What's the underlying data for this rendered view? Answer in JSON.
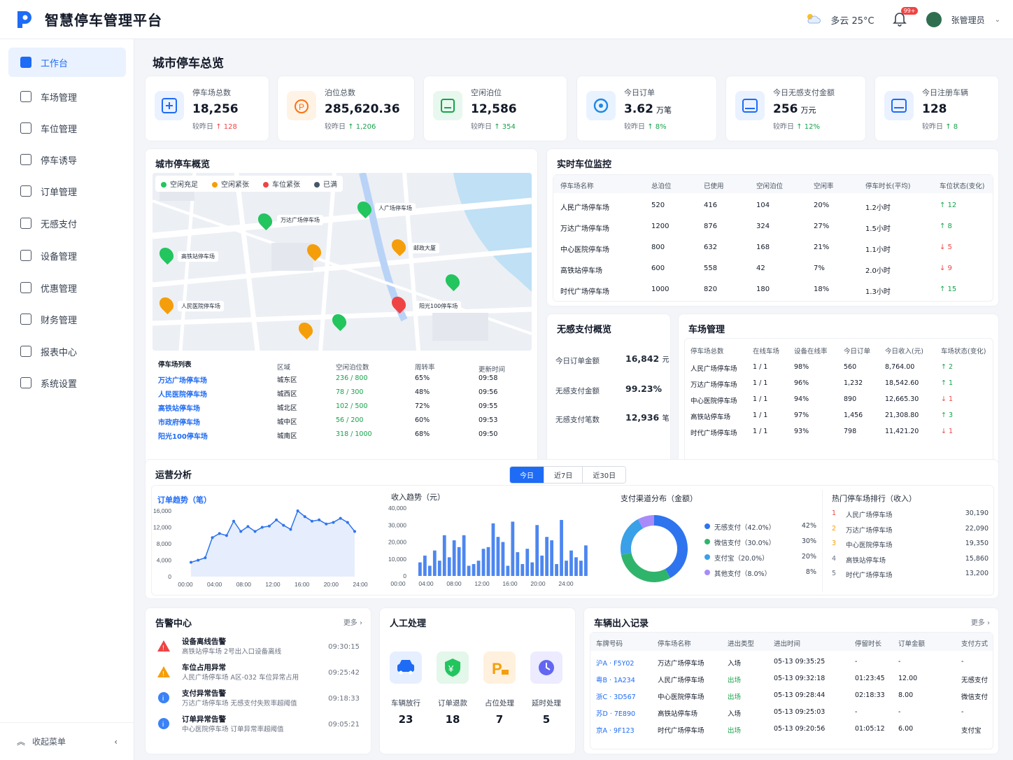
{
  "app": {
    "title": "智慧停车管理平台",
    "weather": "多云  25°C",
    "notif_badge": "99+",
    "user": "张管理员"
  },
  "nav": {
    "items": [
      "工作台",
      "车场管理",
      "车位管理",
      "停车诱导",
      "订单管理",
      "无感支付",
      "设备管理",
      "优惠管理",
      "财务管理",
      "报表中心",
      "系统设置"
    ],
    "collapse": "收起菜单"
  },
  "page_title": "城市停车总览",
  "kpis": [
    {
      "label": "停车场总数",
      "value": "18,256",
      "unit": "",
      "sub": "较昨日",
      "delta": "↑ 128"
    },
    {
      "label": "泊位总数",
      "value": "285,620.36",
      "unit": "",
      "sub": "较昨日",
      "delta": "↑ 1,206"
    },
    {
      "label": "空闲泊位",
      "value": "12,586",
      "unit": "",
      "sub": "较昨日",
      "delta": "↑ 354"
    },
    {
      "label": "今日订单",
      "value": "3.62",
      "unit": "万笔",
      "sub": "较昨日",
      "delta": "↑ 8%"
    },
    {
      "label": "今日无感支付金额",
      "value": "256",
      "unit": "万元",
      "sub": "较昨日",
      "delta": "↑ 12%"
    },
    {
      "label": "今日注册车辆",
      "value": "128",
      "unit": "",
      "sub": "较昨日",
      "delta": "↑ 8"
    }
  ],
  "overview": {
    "title": "城市停车概览",
    "legend": [
      {
        "label": "空闲充足",
        "color": "#22c55e"
      },
      {
        "label": "空闲紧张",
        "color": "#f59e0b"
      },
      {
        "label": "车位紧张",
        "color": "#ef4444"
      },
      {
        "label": "已满",
        "color": "#475569"
      }
    ],
    "map_labels": [
      "万达广场停车场",
      "人广场停车场",
      "邮政大厦",
      "高铁站停车场",
      "人民医院停车场",
      "阳光100停车场"
    ],
    "list_title": "停车场列表",
    "list_headers": [
      "区域",
      "空闲泊位数",
      "周转率",
      "更新时间"
    ],
    "rows": [
      [
        "万达广场停车场",
        "城东区",
        "236 / 800",
        "65%",
        "09:58"
      ],
      [
        "人民医院停车场",
        "城西区",
        "78 / 300",
        "48%",
        "09:56"
      ],
      [
        "高铁站停车场",
        "城北区",
        "102 / 500",
        "72%",
        "09:55"
      ],
      [
        "市政府停车场",
        "城中区",
        "56 / 200",
        "60%",
        "09:53"
      ],
      [
        "阳光100停车场",
        "城南区",
        "318 / 1000",
        "68%",
        "09:50"
      ]
    ]
  },
  "monitor": {
    "title": "实时车位监控",
    "headers": [
      "停车场名称",
      "总泊位",
      "已使用",
      "空闲泊位",
      "空闲率",
      "停车时长(平均)",
      "车位状态(变化)"
    ],
    "rows": [
      [
        "人民广场停车场",
        "520",
        "416",
        "104",
        "20%",
        "1.2小时",
        "↑ 12"
      ],
      [
        "万达广场停车场",
        "1200",
        "876",
        "324",
        "27%",
        "1.5小时",
        "↑ 8"
      ],
      [
        "中心医院停车场",
        "800",
        "632",
        "168",
        "21%",
        "1.1小时",
        "↓ 5"
      ],
      [
        "高铁站停车场",
        "600",
        "558",
        "42",
        "7%",
        "2.0小时",
        "↓ 9"
      ],
      [
        "时代广场停车场",
        "1000",
        "820",
        "180",
        "18%",
        "1.3小时",
        "↑ 15"
      ]
    ]
  },
  "pay": {
    "title": "无感支付概览",
    "items": [
      {
        "label": "今日订单金额",
        "value": "16,842",
        "unit": "元"
      },
      {
        "label": "无感支付金额",
        "value": "99.23%",
        "unit": ""
      },
      {
        "label": "无感支付笔数",
        "value": "12,936",
        "unit": "笔"
      }
    ]
  },
  "lots": {
    "title": "车场管理",
    "headers": [
      "停车场总数",
      "在线车场",
      "设备在线率",
      "今日订单",
      "今日收入(元)",
      "车场状态(变化)"
    ],
    "rows": [
      [
        "人民广场停车场",
        "1 / 1",
        "98%",
        "560",
        "8,764.00",
        "↑ 2"
      ],
      [
        "万达广场停车场",
        "1 / 1",
        "96%",
        "1,232",
        "18,542.60",
        "↑ 1"
      ],
      [
        "中心医院停车场",
        "1 / 1",
        "94%",
        "890",
        "12,665.30",
        "↓ 1"
      ],
      [
        "高铁站停车场",
        "1 / 1",
        "97%",
        "1,456",
        "21,308.80",
        "↑ 3"
      ],
      [
        "时代广场停车场",
        "1 / 1",
        "93%",
        "798",
        "11,421.20",
        "↓ 1"
      ]
    ]
  },
  "ops": {
    "title": "运营分析",
    "tabs": [
      "今日",
      "近7日",
      "近30日"
    ],
    "payment_title": "支付渠道分布（金额）",
    "rank_title": "热门停车场排行（收入）"
  },
  "chart_data": [
    {
      "type": "line",
      "title": "订单趋势（笔）",
      "x": [
        "00:00",
        "01:00",
        "02:00",
        "03:00",
        "04:00",
        "05:00",
        "06:00",
        "07:00",
        "08:00",
        "09:00",
        "10:00",
        "11:00",
        "12:00",
        "13:00",
        "14:00",
        "15:00",
        "16:00",
        "17:00",
        "18:00",
        "19:00",
        "20:00",
        "21:00",
        "22:00",
        "23:00"
      ],
      "values": [
        3500,
        4000,
        4600,
        9500,
        10500,
        10000,
        13500,
        11000,
        12200,
        11000,
        12000,
        12300,
        13800,
        12500,
        11500,
        16000,
        14600,
        13500,
        13800,
        12800,
        13200,
        14200,
        13200,
        11000
      ],
      "ylim": [
        0,
        16000
      ],
      "yticks": [
        "16,000",
        "12,000",
        "8,000",
        "4,000",
        "0"
      ],
      "xticks": [
        "00:00",
        "04:00",
        "08:00",
        "12:00",
        "16:00",
        "20:00",
        "24:00"
      ]
    },
    {
      "type": "bar",
      "title": "收入趋势（元）",
      "values": [
        8000,
        12000,
        6000,
        15000,
        9000,
        24000,
        11000,
        21000,
        17000,
        24000,
        6000,
        7000,
        9000,
        16000,
        17000,
        31000,
        23000,
        20000,
        6000,
        32000,
        14000,
        7000,
        16000,
        8000,
        30000,
        12000,
        23000,
        21000,
        7000,
        33000,
        9000,
        15000,
        11000,
        9000,
        18000
      ],
      "ylim": [
        0,
        40000
      ],
      "yticks": [
        "40,000",
        "30,000",
        "20,000",
        "10,000",
        "0"
      ],
      "xticks": [
        "00:00",
        "04:00",
        "08:00",
        "12:00",
        "16:00",
        "20:00",
        "24:00"
      ]
    },
    {
      "type": "pie",
      "title": "支付渠道分布（金额）",
      "categories": [
        "无感支付（42.0%）",
        "微信支付（30.0%）",
        "支付宝（20.0%）",
        "其他支付（8.0%）"
      ],
      "values": [
        42,
        30,
        20,
        8
      ],
      "labels": [
        "42%",
        "30%",
        "20%",
        "8%"
      ],
      "colors": [
        "#2e74ee",
        "#2fb56b",
        "#3aa0e8",
        "#a78bfa"
      ]
    },
    {
      "type": "table",
      "title": "热门停车场排行（收入）",
      "categories": [
        "人民广场停车场",
        "万达广场停车场",
        "中心医院停车场",
        "高铁站停车场",
        "时代广场停车场"
      ],
      "values": [
        "30,190",
        "22,090",
        "19,350",
        "15,860",
        "13,200"
      ]
    }
  ],
  "alarms": {
    "title": "告警中心",
    "more": "更多 ›",
    "items": [
      {
        "title": "设备离线告警",
        "desc": "高铁站停车场  2号出入口设备离线",
        "time": "09:30:15",
        "color": "#ef4444"
      },
      {
        "title": "车位占用异常",
        "desc": "人民广场停车场 A区-032 车位异常占用",
        "time": "09:25:42",
        "color": "#f59e0b"
      },
      {
        "title": "支付异常告警",
        "desc": "万达广场停车场  无感支付失败率超阈值",
        "time": "09:18:33",
        "color": "#3b82f6"
      },
      {
        "title": "订单异常告警",
        "desc": "中心医院停车场  订单异常率超阈值",
        "time": "09:05:21",
        "color": "#3b82f6"
      }
    ]
  },
  "manual": {
    "title": "人工处理",
    "items": [
      {
        "label": "车辆放行",
        "value": "23"
      },
      {
        "label": "订单退款",
        "value": "18"
      },
      {
        "label": "占位处理",
        "value": "7"
      },
      {
        "label": "延时处理",
        "value": "5"
      }
    ]
  },
  "records": {
    "title": "车辆出入记录",
    "more": "更多 ›",
    "headers": [
      "车牌号码",
      "停车场名称",
      "进出类型",
      "进出时间",
      "停留时长",
      "订单金额",
      "支付方式"
    ],
    "rows": [
      [
        "沪A · F5Y02",
        "万达广场停车场",
        "入场",
        "05-13 09:35:25",
        "-",
        "-",
        "-"
      ],
      [
        "粤B · 1A234",
        "人民广场停车场",
        "出场",
        "05-13 09:32:18",
        "01:23:45",
        "12.00",
        "无感支付"
      ],
      [
        "浙C · 3D567",
        "中心医院停车场",
        "出场",
        "05-13 09:28:44",
        "02:18:33",
        "8.00",
        "微信支付"
      ],
      [
        "苏D · 7E890",
        "高铁站停车场",
        "入场",
        "05-13 09:25:03",
        "-",
        "-",
        "-"
      ],
      [
        "京A · 9F123",
        "时代广场停车场",
        "出场",
        "05-13 09:20:56",
        "01:05:12",
        "6.00",
        "支付宝"
      ]
    ]
  }
}
